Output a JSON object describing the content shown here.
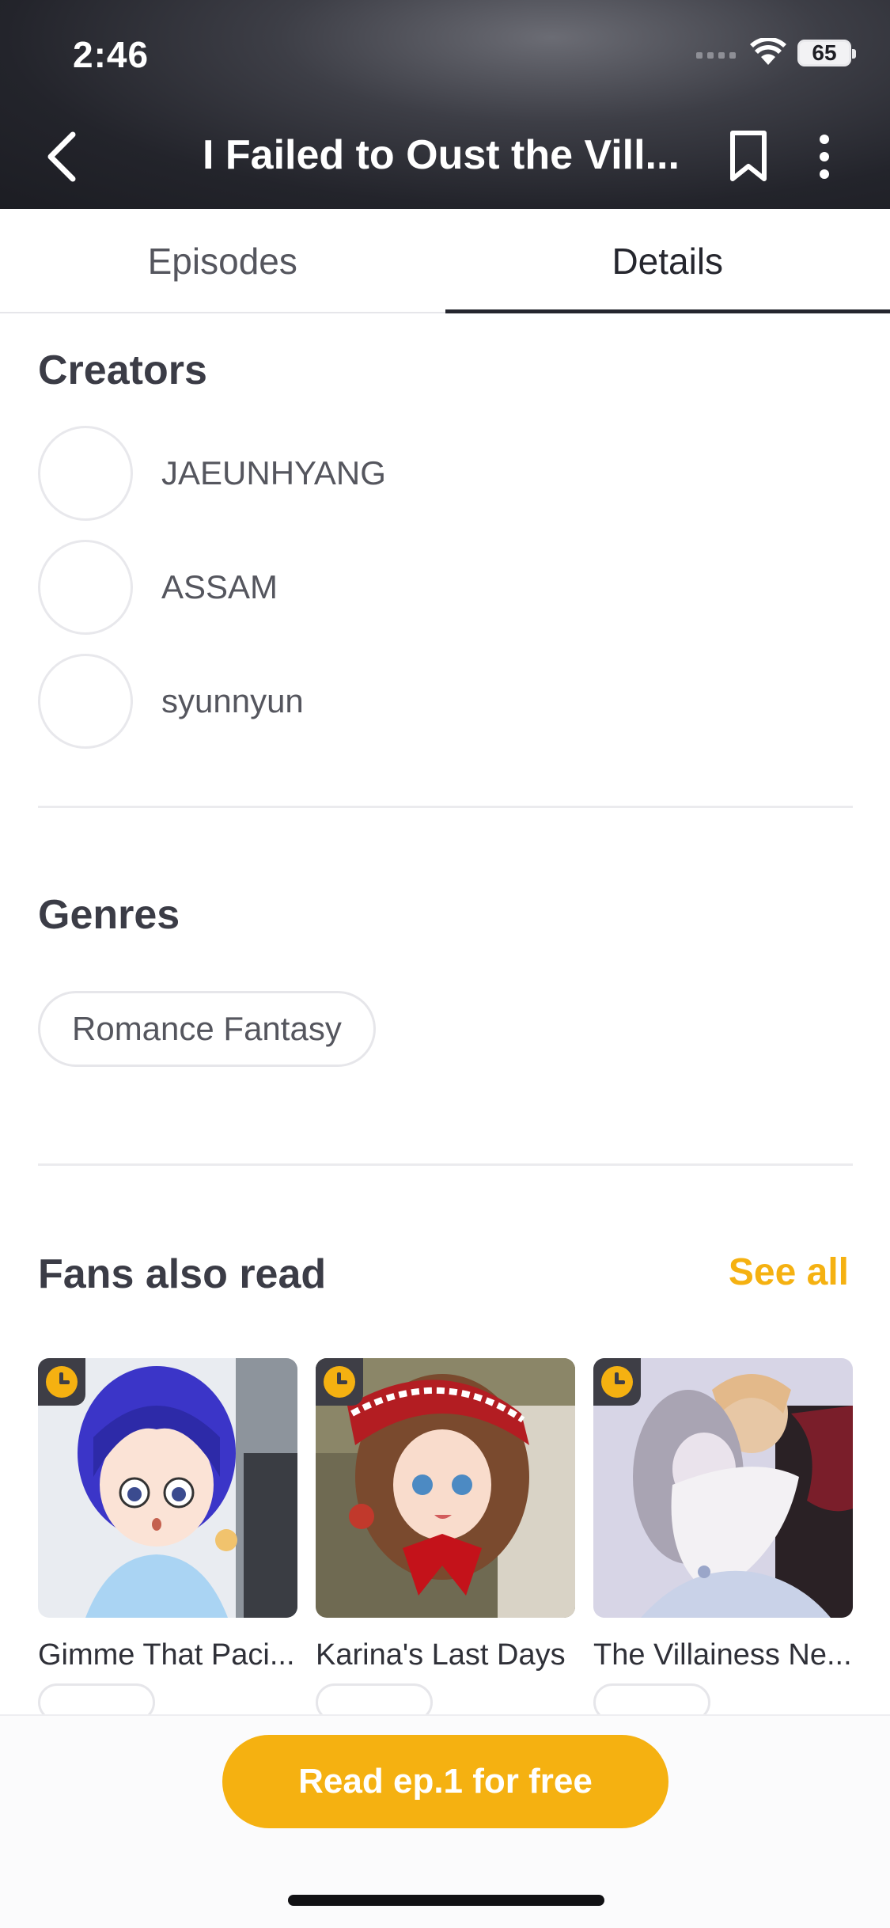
{
  "status_bar": {
    "time": "2:46",
    "battery": "65"
  },
  "header": {
    "title": "I Failed to Oust the Vill..."
  },
  "tabs": [
    {
      "label": "Episodes",
      "active": false
    },
    {
      "label": "Details",
      "active": true
    }
  ],
  "creators": {
    "title": "Creators",
    "items": [
      {
        "name": "JAEUNHYANG"
      },
      {
        "name": "ASSAM"
      },
      {
        "name": "syunnyun"
      }
    ]
  },
  "genres": {
    "title": "Genres",
    "items": [
      "Romance Fantasy"
    ]
  },
  "fans_also_read": {
    "title": "Fans also read",
    "see_all": "See all",
    "items": [
      {
        "title": "Gimme That Paci..."
      },
      {
        "title": "Karina's Last Days"
      },
      {
        "title": "The Villainess Ne..."
      }
    ]
  },
  "cta": {
    "label": "Read ep.1 for free"
  },
  "colors": {
    "accent": "#f5b111",
    "text": "#3b3c46",
    "header_bg": "#23242b"
  }
}
